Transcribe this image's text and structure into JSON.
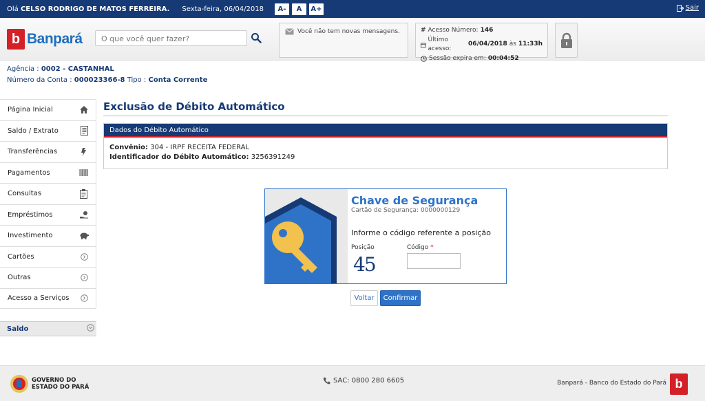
{
  "topbar": {
    "greeting_prefix": "Olá",
    "user_name": "CELSO RODRIGO DE MATOS FERREIRA.",
    "date": "Sexta-feira, 06/04/2018",
    "font_buttons": [
      "A-",
      "A",
      "A+"
    ],
    "exit_label": "Sair"
  },
  "header": {
    "logo_text": "Banpará",
    "search_placeholder": "O que você quer fazer?",
    "messages": "Você não tem novas mensagens.",
    "access_number_label": "Acesso Número:",
    "access_number": "146",
    "last_access_label": "Último acesso:",
    "last_access_date": "06/04/2018",
    "last_access_at": "às",
    "last_access_time": "11:33h",
    "session_label": "Sessão expira em:",
    "session_time": "00:04:52"
  },
  "account": {
    "agency_label": "Agência :",
    "agency": "0002 - CASTANHAL",
    "number_label": "Número da Conta :",
    "number": "000023366-8",
    "type_label": "Tipo :",
    "type": "Conta Corrente"
  },
  "sidebar": {
    "items": [
      {
        "label": "Página Inicial",
        "icon": "home-icon"
      },
      {
        "label": "Saldo / Extrato",
        "icon": "document-icon"
      },
      {
        "label": "Transferências",
        "icon": "transfer-icon"
      },
      {
        "label": "Pagamentos",
        "icon": "barcode-icon"
      },
      {
        "label": "Consultas",
        "icon": "clipboard-icon"
      },
      {
        "label": "Empréstimos",
        "icon": "hand-money-icon"
      },
      {
        "label": "Investimento",
        "icon": "piggy-bank-icon"
      },
      {
        "label": "Cartões",
        "icon": "chevron-right-icon"
      },
      {
        "label": "Outras",
        "icon": "chevron-right-icon"
      },
      {
        "label": "Acesso a Serviços",
        "icon": "chevron-right-icon"
      }
    ],
    "saldo_label": "Saldo"
  },
  "main": {
    "title": "Exclusão de Débito Automático",
    "panel_title": "Dados do Débito Automático",
    "convenio_label": "Convênio:",
    "convenio": "304 - IRPF RECEITA FEDERAL",
    "identificador_label": "Identificador do Débito Automático:",
    "identificador": "3256391249"
  },
  "security": {
    "title": "Chave de Segurança",
    "card": "Cartão de Segurança: 0000000129",
    "instruction": "Informe o código referente a posição",
    "position_label": "Posição",
    "position_value": "45",
    "code_label": "Código",
    "code_required": "*",
    "code_value": ""
  },
  "buttons": {
    "back": "Voltar",
    "confirm": "Confirmar"
  },
  "footer": {
    "gov_line1": "GOVERNO DO",
    "gov_line2": "ESTADO DO PARÁ",
    "sac": "SAC: 0800 280 6605",
    "bank": "Banpará - Banco do Estado do Pará"
  },
  "colors": {
    "primary": "#163a75",
    "accent": "#2f73c8",
    "brand_red": "#d42027"
  }
}
